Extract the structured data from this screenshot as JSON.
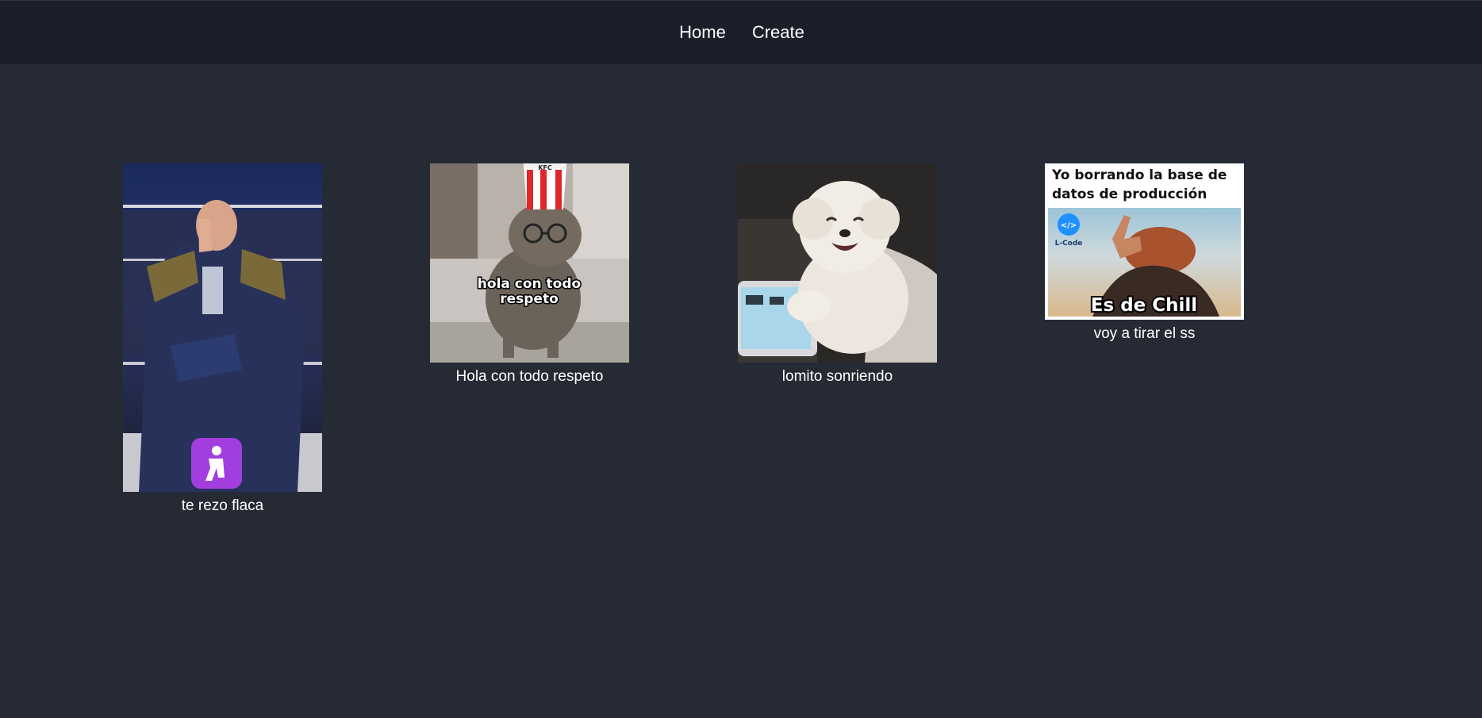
{
  "nav": {
    "home_label": "Home",
    "create_label": "Create"
  },
  "posts": [
    {
      "caption": "te rezo flaca",
      "image_desc": "man praying in wrestling ring with praying emoji"
    },
    {
      "caption": "Hola con todo respeto",
      "overlay_text_1": "hola con todo",
      "overlay_text_2": "respeto",
      "bucket_text": "KFC"
    },
    {
      "caption": "lomito sonriendo"
    },
    {
      "caption": "voy a tirar el ss",
      "header_text_1": "Yo borrando la base de",
      "header_text_2": "datos de producción",
      "logo_text": "L-Code",
      "bottom_text": "Es de Chill"
    }
  ],
  "colors": {
    "background": "#252a34",
    "navbar": "#1b1f29",
    "text": "#ffffff",
    "emoji_purple": "#a23ee0"
  }
}
